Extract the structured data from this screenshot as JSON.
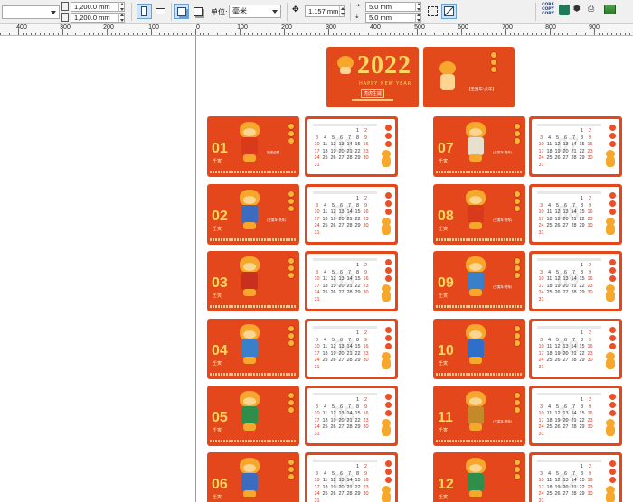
{
  "propbar": {
    "width_value": "1,200.0 mm",
    "height_value": "1,200.0 mm",
    "unit_label": "单位:",
    "unit_value": "毫米",
    "nudge_value": "1.157 mm",
    "dup_x_value": "5.0 mm",
    "dup_y_value": "5.0 mm",
    "tool_icons": [
      "page-portrait-icon",
      "page-landscape-icon",
      "all-pages-icon",
      "current-page-icon",
      "nudge-icon",
      "snap-icon",
      "trim-icon"
    ],
    "right_icons": [
      "core-copy-icon",
      "plugin-icon",
      "stamp-icon",
      "print-icon",
      "image-icon"
    ],
    "right_label": "CORE COPY COPY"
  },
  "ruler": {
    "labels": [
      "400",
      "300",
      "200",
      "100",
      "0",
      "100",
      "200",
      "300",
      "400",
      "500",
      "600",
      "700",
      "800",
      "900"
    ]
  },
  "cover": {
    "year": "2022",
    "greeting": "HAPPY NEW YEAR",
    "stamp": "虎虎生威",
    "back_text": "【壬寅年·虎年】"
  },
  "months": [
    {
      "num": "01",
      "sub": "壬寅",
      "banner": "福虎迎春"
    },
    {
      "num": "02",
      "sub": "壬寅",
      "banner": "(壬寅年·虎年)"
    },
    {
      "num": "03",
      "sub": "壬寅",
      "banner": ""
    },
    {
      "num": "04",
      "sub": "壬寅",
      "banner": ""
    },
    {
      "num": "05",
      "sub": "壬寅",
      "banner": ""
    },
    {
      "num": "06",
      "sub": "壬寅",
      "banner": ""
    },
    {
      "num": "07",
      "sub": "壬寅",
      "banner": "(壬寅年·虎年)"
    },
    {
      "num": "08",
      "sub": "壬寅",
      "banner": "(壬寅年·虎年)"
    },
    {
      "num": "09",
      "sub": "壬寅",
      "banner": "(壬寅年·虎年)"
    },
    {
      "num": "10",
      "sub": "壬寅",
      "banner": ""
    },
    {
      "num": "11",
      "sub": "壬寅",
      "banner": "(壬寅年·虎年)"
    },
    {
      "num": "12",
      "sub": "壬寅",
      "banner": ""
    }
  ],
  "calendar": {
    "weekday_row": [
      "日",
      "一",
      "二",
      "三",
      "四",
      "五",
      "六"
    ],
    "dates": [
      "",
      "",
      "",
      "",
      "",
      "1",
      "2",
      "3",
      "4",
      "5",
      "6",
      "7",
      "8",
      "9",
      "10",
      "11",
      "12",
      "13",
      "14",
      "15",
      "16",
      "17",
      "18",
      "19",
      "20",
      "21",
      "22",
      "23",
      "24",
      "25",
      "26",
      "27",
      "28",
      "29",
      "30",
      "31"
    ]
  },
  "colors": {
    "card_red": "#e4471c",
    "gold": "#ffd75e",
    "active_tool": "#cde3f7"
  }
}
